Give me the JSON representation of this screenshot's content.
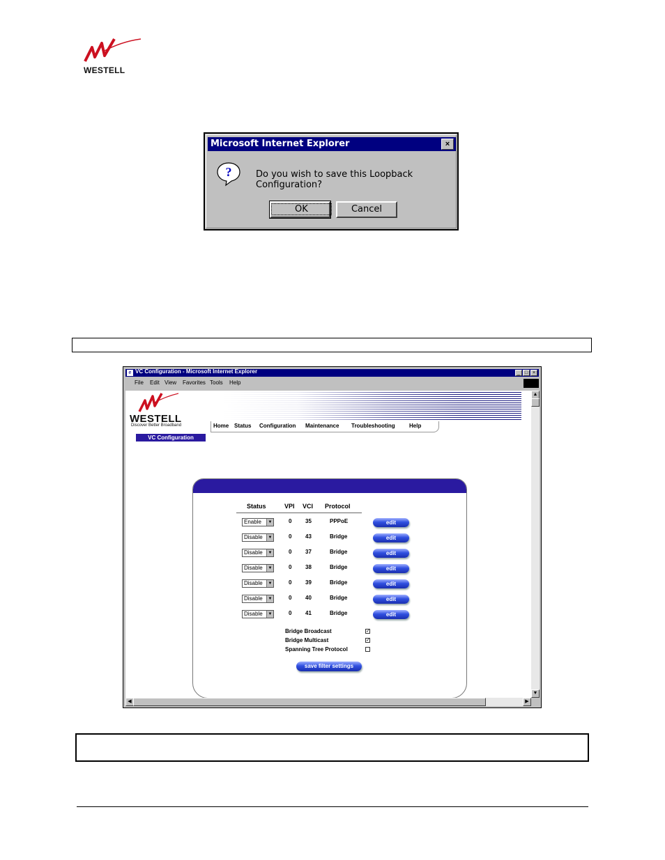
{
  "page_logo": {
    "text": "WESTELL"
  },
  "dialog": {
    "title": "Microsoft Internet Explorer",
    "close_icon": "×",
    "message": "Do you wish to save this Loopback Configuration?",
    "ok_label": "OK",
    "cancel_label": "Cancel"
  },
  "browser": {
    "title": "VC Configuration - Microsoft Internet Explorer",
    "menu": [
      "File",
      "Edit",
      "View",
      "Favorites",
      "Tools",
      "Help"
    ]
  },
  "westell_page": {
    "brand": "WESTELL",
    "tagline": "Discover  Better  Broadband",
    "nav": [
      "Home",
      "Status",
      "Configuration",
      "Maintenance",
      "Troubleshooting",
      "Help"
    ],
    "section_label": "VC Configuration",
    "table": {
      "headers": [
        "Status",
        "VPI",
        "VCI",
        "Protocol"
      ],
      "rows": [
        {
          "status": "Enable",
          "vpi": "0",
          "vci": "35",
          "protocol": "PPPoE",
          "action": "edit"
        },
        {
          "status": "Disable",
          "vpi": "0",
          "vci": "43",
          "protocol": "Bridge",
          "action": "edit"
        },
        {
          "status": "Disable",
          "vpi": "0",
          "vci": "37",
          "protocol": "Bridge",
          "action": "edit"
        },
        {
          "status": "Disable",
          "vpi": "0",
          "vci": "38",
          "protocol": "Bridge",
          "action": "edit"
        },
        {
          "status": "Disable",
          "vpi": "0",
          "vci": "39",
          "protocol": "Bridge",
          "action": "edit"
        },
        {
          "status": "Disable",
          "vpi": "0",
          "vci": "40",
          "protocol": "Bridge",
          "action": "edit"
        },
        {
          "status": "Disable",
          "vpi": "0",
          "vci": "41",
          "protocol": "Bridge",
          "action": "edit"
        }
      ]
    },
    "options": [
      {
        "label": "Bridge Broadcast",
        "checked": true
      },
      {
        "label": "Bridge Multicast",
        "checked": true
      },
      {
        "label": "Spanning Tree Protocol",
        "checked": false
      }
    ],
    "save_button": "save filter settings"
  },
  "colors": {
    "dialog_title": "#000080",
    "accent": "#2a1aa0",
    "logo_red": "#cc1020"
  }
}
